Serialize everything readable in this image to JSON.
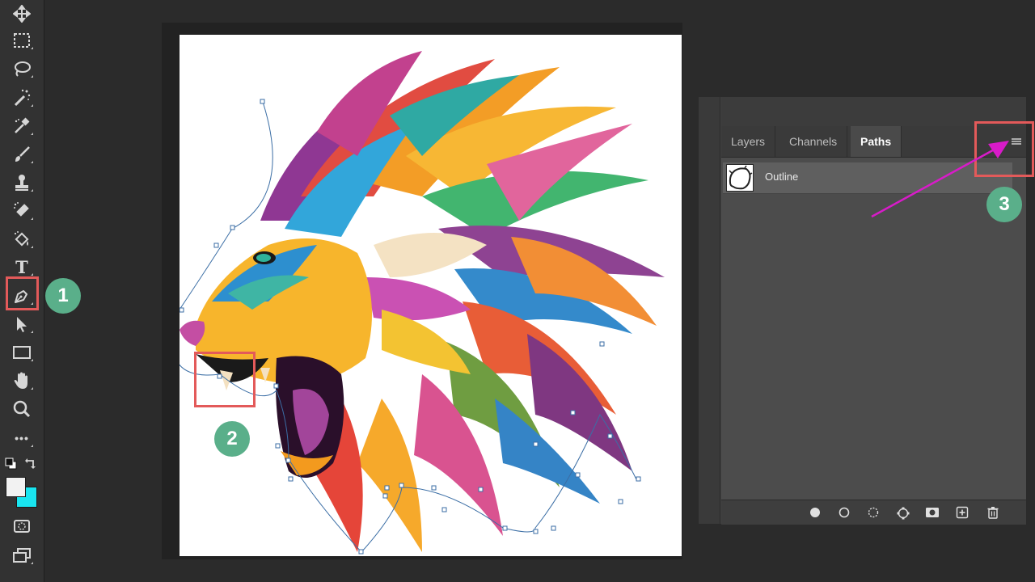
{
  "toolbar": {
    "tools": [
      "move-icon",
      "marquee-icon",
      "lasso-icon",
      "magic-wand-icon",
      "eyedropper-icon",
      "brush-icon",
      "stamp-icon",
      "eraser-icon",
      "paint-bucket-icon",
      "type-icon",
      "pen-icon",
      "path-select-icon",
      "rectangle-icon",
      "hand-icon",
      "zoom-icon",
      "more-icon"
    ],
    "type_tool_label": "T",
    "more_label": "•••",
    "foreground_color": "#f2f2f2",
    "background_color": "#19e5f0"
  },
  "panel": {
    "tabs": [
      {
        "label": "Layers",
        "active": false
      },
      {
        "label": "Channels",
        "active": false
      },
      {
        "label": "Paths",
        "active": true
      }
    ],
    "paths": [
      {
        "name": "Outline",
        "selected": true
      }
    ],
    "footer_icons": [
      "fill-path-icon",
      "stroke-path-icon",
      "load-selection-icon",
      "make-work-path-icon",
      "add-mask-icon",
      "new-path-icon",
      "delete-path-icon"
    ]
  },
  "annotations": {
    "step1": "1",
    "step2": "2",
    "step3": "3",
    "box_color": "#e35a5a",
    "badge_color": "#5aaf8a",
    "arrow_color": "#d81bc9"
  }
}
